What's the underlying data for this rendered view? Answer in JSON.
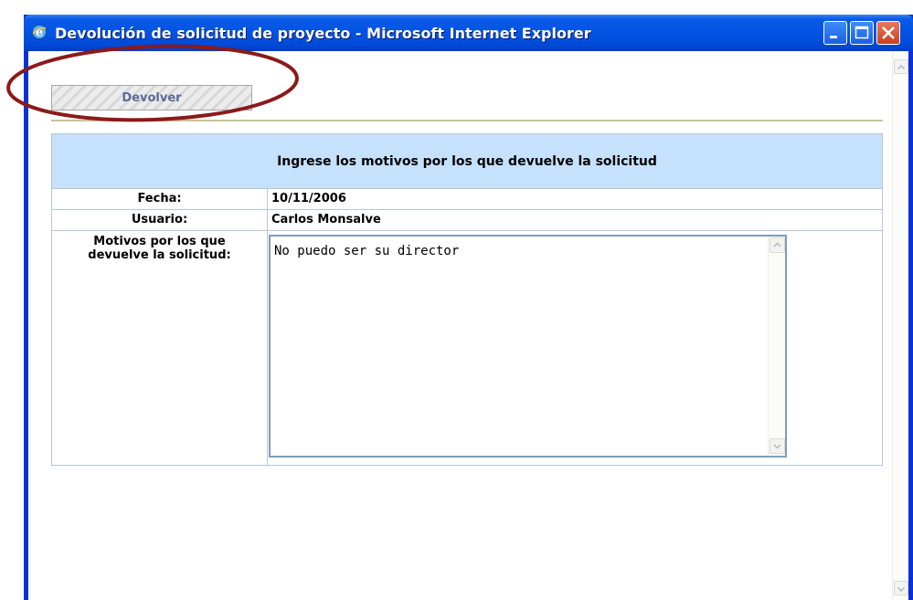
{
  "window": {
    "title": "Devolución de solicitud de proyecto - Microsoft Internet Explorer"
  },
  "toolbar": {
    "devolver_label": "Devolver"
  },
  "form": {
    "header": "Ingrese los motivos por los que devuelve la solicitud",
    "fecha_label": "Fecha:",
    "fecha_value": "10/11/2006",
    "usuario_label": "Usuario:",
    "usuario_value": "Carlos Monsalve",
    "motivos_label_line1": "Motivos por los que",
    "motivos_label_line2": "devuelve la solicitud:",
    "motivos_value": "No puedo ser su director"
  },
  "colors": {
    "titlebar": "#0253e4",
    "form_header_bg": "#c6e1fb",
    "annotation_ring": "#8b1a1a"
  },
  "icons": {
    "app": "internet-explorer-icon",
    "minimize": "minimize-icon",
    "maximize": "maximize-icon",
    "close": "close-icon"
  }
}
